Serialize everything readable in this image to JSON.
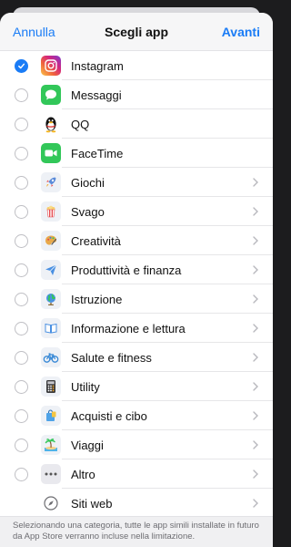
{
  "nav": {
    "cancel_label": "Annulla",
    "title": "Scegli app",
    "next_label": "Avanti"
  },
  "items": [
    {
      "label": "Instagram",
      "icon": "instagram-icon",
      "checked": true,
      "chevron": false
    },
    {
      "label": "Messaggi",
      "icon": "messages-icon",
      "checked": false,
      "chevron": false
    },
    {
      "label": "QQ",
      "icon": "qq-penguin-icon",
      "checked": false,
      "chevron": false
    },
    {
      "label": "FaceTime",
      "icon": "facetime-icon",
      "checked": false,
      "chevron": false
    },
    {
      "label": "Giochi",
      "icon": "rocket-icon",
      "checked": false,
      "chevron": true
    },
    {
      "label": "Svago",
      "icon": "popcorn-icon",
      "checked": false,
      "chevron": true
    },
    {
      "label": "Creatività",
      "icon": "palette-icon",
      "checked": false,
      "chevron": true
    },
    {
      "label": "Produttività e finanza",
      "icon": "paper-plane-icon",
      "checked": false,
      "chevron": true
    },
    {
      "label": "Istruzione",
      "icon": "globe-icon",
      "checked": false,
      "chevron": true
    },
    {
      "label": "Informazione e lettura",
      "icon": "book-icon",
      "checked": false,
      "chevron": true
    },
    {
      "label": "Salute e fitness",
      "icon": "bicycle-icon",
      "checked": false,
      "chevron": true
    },
    {
      "label": "Utility",
      "icon": "calculator-icon",
      "checked": false,
      "chevron": true
    },
    {
      "label": "Acquisti e cibo",
      "icon": "shopping-bag-icon",
      "checked": false,
      "chevron": true
    },
    {
      "label": "Viaggi",
      "icon": "beach-icon",
      "checked": false,
      "chevron": true
    },
    {
      "label": "Altro",
      "icon": "more-icon",
      "checked": false,
      "chevron": true
    },
    {
      "label": "Siti web",
      "icon": "compass-icon",
      "checked": false,
      "chevron": true,
      "no_radio": true
    }
  ],
  "footer": {
    "text": "Selezionando una categoria, tutte le app simili installate in futuro da App Store verranno incluse nella limitazione."
  },
  "colors": {
    "accent": "#1a7cf6"
  }
}
